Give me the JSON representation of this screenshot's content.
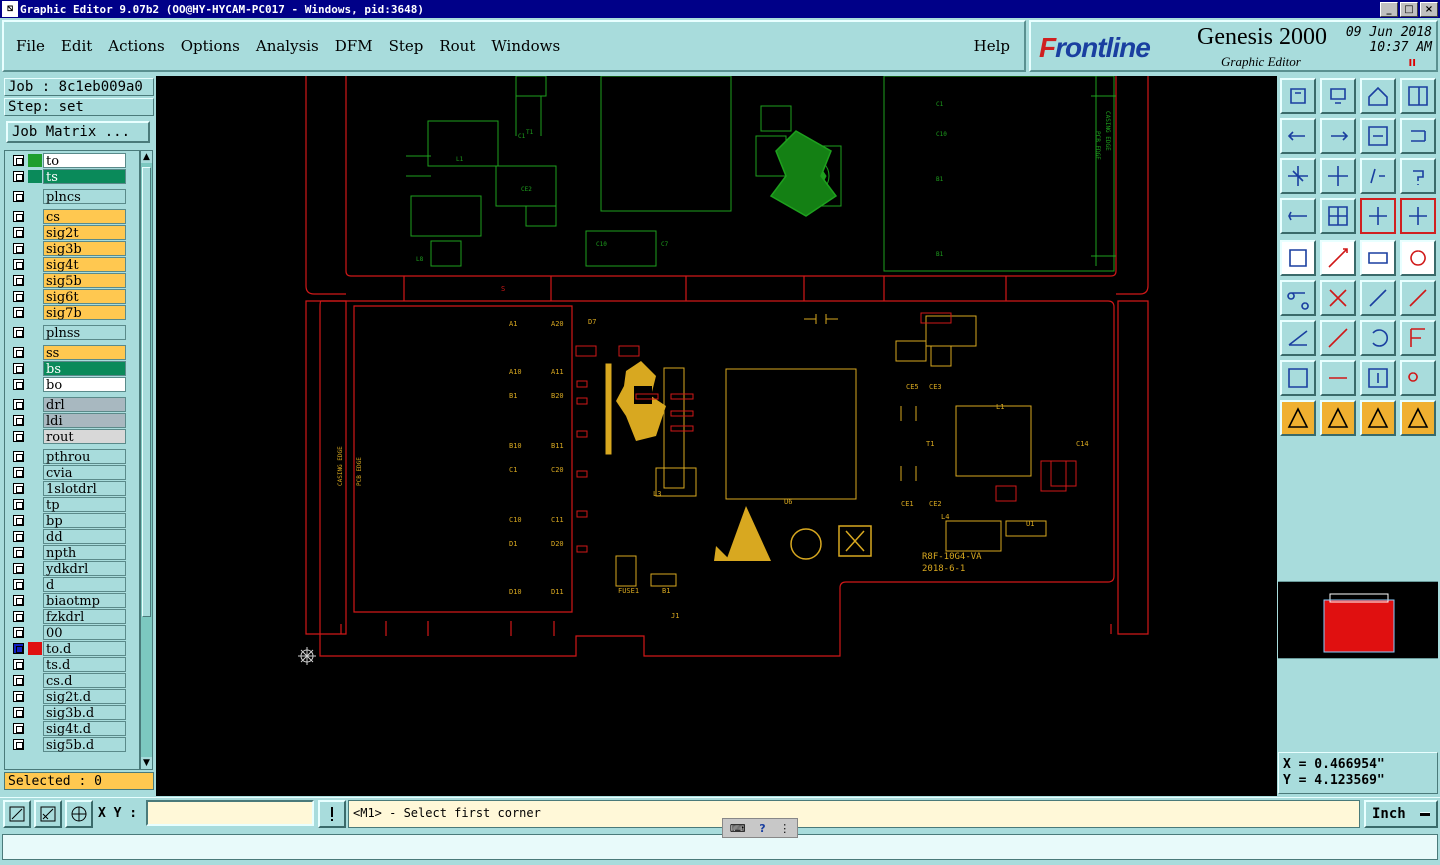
{
  "window": {
    "title": "Graphic Editor 9.07b2 (OO@HY-HYCAM-PC017 - Windows, pid:3648)",
    "controls": [
      "_",
      "□",
      "×"
    ]
  },
  "menu": {
    "items": [
      "File",
      "Edit",
      "Actions",
      "Options",
      "Analysis",
      "DFM",
      "Step",
      "Rout",
      "Windows"
    ],
    "help": "Help"
  },
  "brand": {
    "logo_prefix": "F",
    "logo_rest": "rontline",
    "product": "Genesis 2000",
    "subtitle": "Graphic Editor",
    "date": "09 Jun 2018",
    "time": "10:37 AM",
    "pause_indicator": "II"
  },
  "job": {
    "job_label": "Job : 8c1eb009a0",
    "step_label": "Step: set",
    "matrix_button": "Job Matrix ..."
  },
  "layers": [
    {
      "name": "to",
      "color": "#ffffff",
      "swatch": "#1e9e2e"
    },
    {
      "name": "ts",
      "color": "#0a8a5a",
      "swatch": "#0a8a5a"
    },
    {
      "name": "plncs",
      "color": "#a8dcdc",
      "swatch": ""
    },
    {
      "name": "cs",
      "color": "#ffc850",
      "swatch": ""
    },
    {
      "name": "sig2t",
      "color": "#ffc850",
      "swatch": ""
    },
    {
      "name": "sig3b",
      "color": "#ffc850",
      "swatch": ""
    },
    {
      "name": "sig4t",
      "color": "#ffc850",
      "swatch": ""
    },
    {
      "name": "sig5b",
      "color": "#ffc850",
      "swatch": ""
    },
    {
      "name": "sig6t",
      "color": "#ffc850",
      "swatch": ""
    },
    {
      "name": "sig7b",
      "color": "#ffc850",
      "swatch": ""
    },
    {
      "name": "plnss",
      "color": "#a8dcdc",
      "swatch": ""
    },
    {
      "name": "ss",
      "color": "#ffc850",
      "swatch": ""
    },
    {
      "name": "bs",
      "color": "#0a8a5a",
      "swatch": ""
    },
    {
      "name": "bo",
      "color": "#ffffff",
      "swatch": ""
    },
    {
      "name": "drl",
      "color": "#a8b8c0",
      "swatch": ""
    },
    {
      "name": "ldi",
      "color": "#a8b8c0",
      "swatch": ""
    },
    {
      "name": "rout",
      "color": "#d8d8d8",
      "swatch": ""
    },
    {
      "name": "pthrou",
      "color": "#a8dcdc",
      "swatch": ""
    },
    {
      "name": "cvia",
      "color": "#a8dcdc",
      "swatch": ""
    },
    {
      "name": "1slotdrl",
      "color": "#a8dcdc",
      "swatch": ""
    },
    {
      "name": "tp",
      "color": "#a8dcdc",
      "swatch": ""
    },
    {
      "name": "bp",
      "color": "#a8dcdc",
      "swatch": ""
    },
    {
      "name": "dd",
      "color": "#a8dcdc",
      "swatch": ""
    },
    {
      "name": "npth",
      "color": "#a8dcdc",
      "swatch": ""
    },
    {
      "name": "ydkdrl",
      "color": "#a8dcdc",
      "swatch": ""
    },
    {
      "name": "d",
      "color": "#a8dcdc",
      "swatch": ""
    },
    {
      "name": "biaotmp",
      "color": "#a8dcdc",
      "swatch": ""
    },
    {
      "name": "fzkdrl",
      "color": "#a8dcdc",
      "swatch": ""
    },
    {
      "name": "00",
      "color": "#a8dcdc",
      "swatch": ""
    },
    {
      "name": "to.d",
      "color": "#a8dcdc",
      "swatch": "#e01010"
    },
    {
      "name": "ts.d",
      "color": "#a8dcdc",
      "swatch": ""
    },
    {
      "name": "cs.d",
      "color": "#a8dcdc",
      "swatch": ""
    },
    {
      "name": "sig2t.d",
      "color": "#a8dcdc",
      "swatch": ""
    },
    {
      "name": "sig3b.d",
      "color": "#a8dcdc",
      "swatch": ""
    },
    {
      "name": "sig4t.d",
      "color": "#a8dcdc",
      "swatch": ""
    },
    {
      "name": "sig5b.d",
      "color": "#a8dcdc",
      "swatch": ""
    }
  ],
  "selected": "Selected : 0",
  "board": {
    "top_label": "S",
    "left_text_1": "CASING EDGE",
    "left_text_2": "PCB EDGE",
    "right_text_1": "PCB EDGE",
    "right_text_2": "CASING EDGE",
    "pin_labels_left": [
      "A1",
      "A10",
      "B1",
      "B10",
      "C1",
      "C10",
      "D1",
      "D10"
    ],
    "pin_labels_right": [
      "A20",
      "A11",
      "B20",
      "B11",
      "C20",
      "C11",
      "D20",
      "D11"
    ],
    "part_number": "R8F-10G4-VA",
    "date_code": "2018-6-1",
    "component_labels": [
      "U5",
      "U6",
      "T1",
      "L1",
      "L3",
      "FUSE1",
      "B1",
      "J1",
      "U1",
      "L4",
      "D7",
      "C7",
      "C8",
      "C14",
      "U3",
      "CE1",
      "CE2",
      "CE3",
      "CE5"
    ]
  },
  "tools": {
    "count": 36
  },
  "coordinates": {
    "x": "X = 0.466954\"",
    "y": "Y = 4.123569\""
  },
  "command": {
    "xy_label": "X Y :",
    "xy_value": "",
    "prompt": "<M1> - Select first corner",
    "unit": "Inch"
  },
  "colors": {
    "background": "#a8dcdc",
    "canvas": "#000000",
    "board_outline": "#d01818",
    "silkscreen_green": "#1ea01e",
    "silkscreen_yellow": "#d8a820",
    "title_bar": "#000088"
  }
}
